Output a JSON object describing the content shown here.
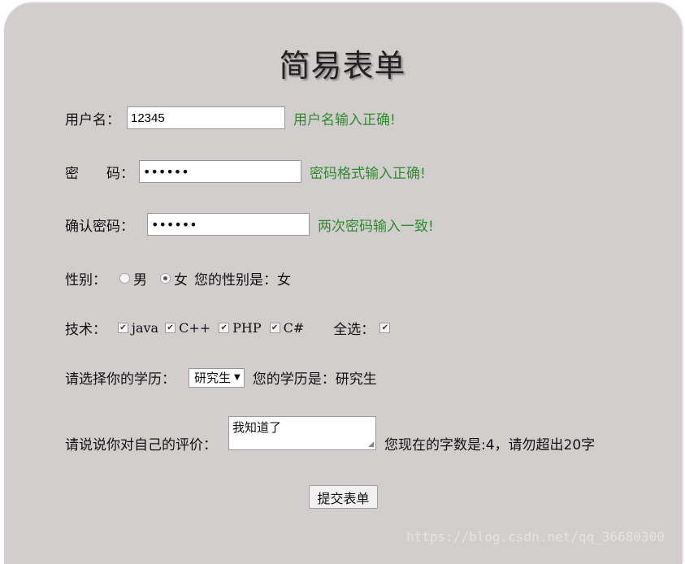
{
  "title": "简易表单",
  "username": {
    "label": "用户名：",
    "value": "12345",
    "message": "用户名输入正确!"
  },
  "password": {
    "label": "密　　码：",
    "value": "••••••",
    "message": "密码格式输入正确!"
  },
  "confirm": {
    "label": "确认密码：",
    "value": "••••••",
    "message": "两次密码输入一致!"
  },
  "gender": {
    "label": "性别：",
    "options": [
      "男",
      "女"
    ],
    "selected": "女",
    "result": "您的性别是：女"
  },
  "tech": {
    "label": "技术：",
    "options": [
      "java",
      "C++",
      "PHP",
      "C#"
    ],
    "select_all": "全选："
  },
  "education": {
    "label": "请选择你的学历：",
    "selected": "研究生",
    "result": "您的学历是：研究生"
  },
  "review": {
    "label": "请说说你对自己的评价：",
    "value": "我知道了",
    "count_text": "您现在的字数是:4，请勿超出20字"
  },
  "submit_label": "提交表单",
  "watermark": "https://blog.csdn.net/qq_36680300"
}
